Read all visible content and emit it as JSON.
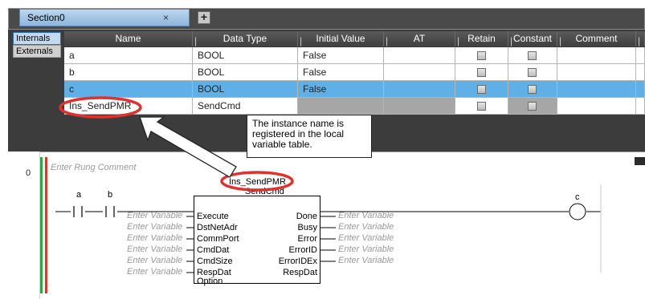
{
  "tabs": [
    {
      "label": "Section0",
      "close": "×"
    }
  ],
  "add_tab_symbol": "+",
  "side_buttons": {
    "internals": "Internals",
    "externals": "Externals"
  },
  "columns": [
    "Name",
    "Data Type",
    "Initial Value",
    "AT",
    "Retain",
    "Constant",
    "Comment"
  ],
  "rows": [
    {
      "name": "a",
      "data_type": "BOOL",
      "initial_value": "False",
      "at": "",
      "comment": ""
    },
    {
      "name": "b",
      "data_type": "BOOL",
      "initial_value": "False",
      "at": "",
      "comment": ""
    },
    {
      "name": "c",
      "data_type": "BOOL",
      "initial_value": "False",
      "at": "",
      "comment": "",
      "selected": true
    },
    {
      "name": "Ins_SendPMR",
      "data_type": "SendCmd",
      "initial_value": "",
      "at": "",
      "comment": ""
    }
  ],
  "callout_text": "The instance name is registered in the local variable table.",
  "ladder": {
    "rung_number": "0",
    "rung_comment_placeholder": "Enter Rung Comment",
    "contacts": [
      "a",
      "b"
    ],
    "coil": "c",
    "instance_name": "Ins_SendPMR",
    "fb_type": "SendCmd",
    "inputs": [
      "Execute",
      "DstNetAdr",
      "CommPort",
      "CmdDat",
      "CmdSize",
      "RespDat",
      "Option"
    ],
    "outputs": [
      "Done",
      "Busy",
      "Error",
      "ErrorID",
      "ErrorIDEx",
      "RespDat"
    ],
    "variable_placeholder": "Enter Variable"
  },
  "colors": {
    "accent_red": "#e0312d",
    "selected_row": "#5fb0e6",
    "left_rail_green": "#2aa84a",
    "right_rail_red": "#d23b2b"
  }
}
